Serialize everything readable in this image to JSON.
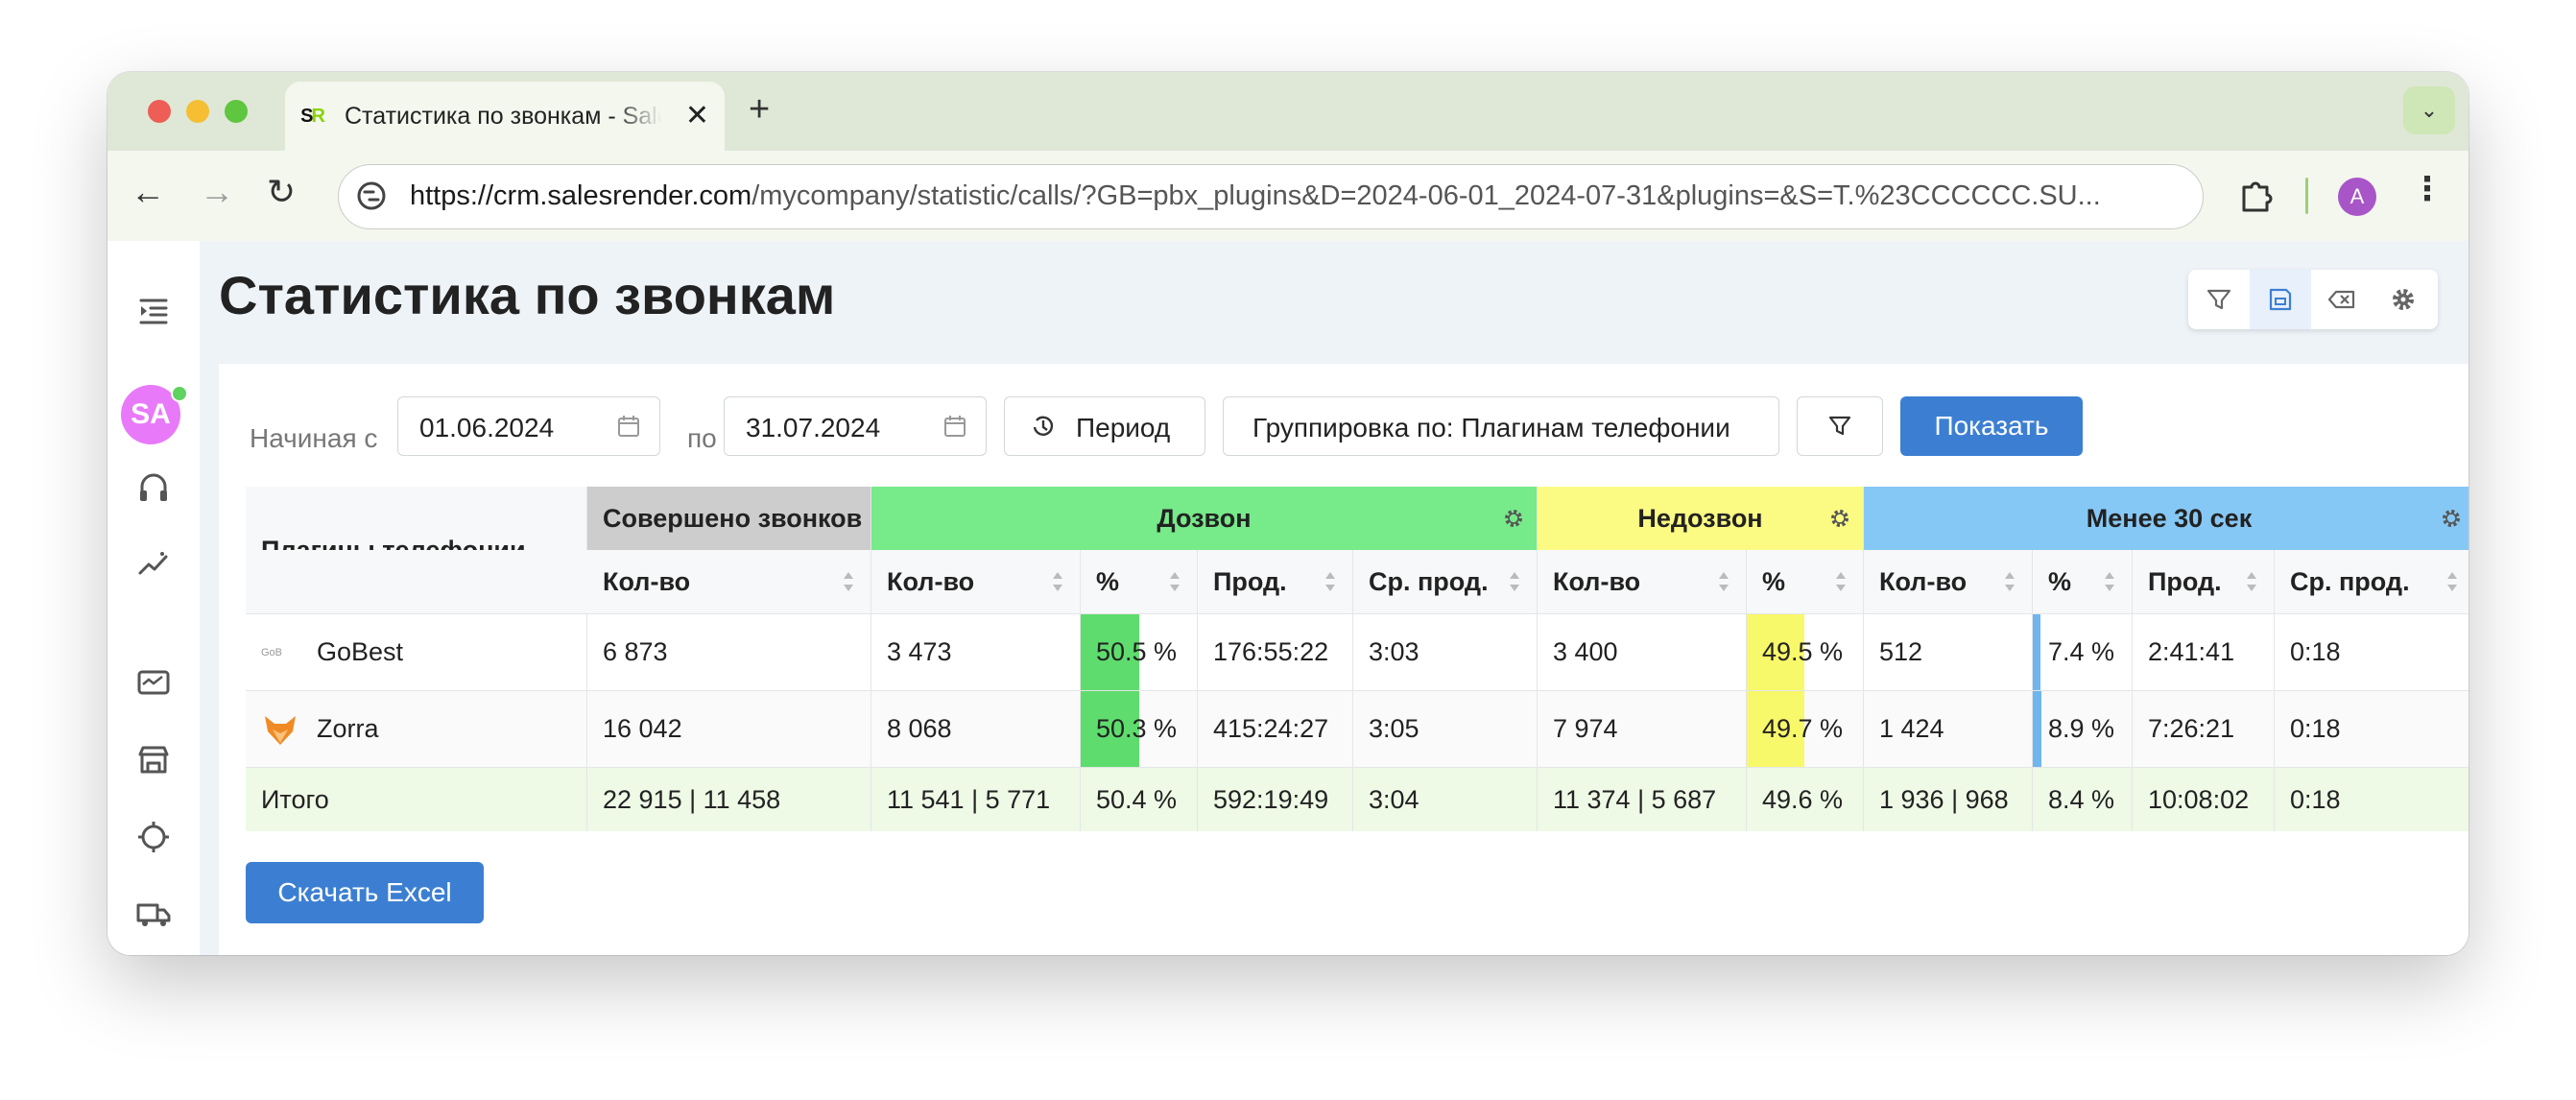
{
  "browser": {
    "tab_title": "Статистика по звонкам - SalesRender",
    "favicon_text_a": "S",
    "favicon_text_b": "R",
    "url_host": "https://crm.salesrender.com",
    "url_path": "/mycompany/statistic/calls/?GB=pbx_plugins&D=2024-06-01_2024-07-31&plugins=&S=T.%23CCCCCC.SU...",
    "profile_initial": "A"
  },
  "sidebar": {
    "avatar_initials": "SA",
    "icons": [
      "indent-icon",
      "headset-icon",
      "analytics-icon",
      "monitor-chart-icon",
      "store-icon",
      "crosshair-icon",
      "truck-icon"
    ]
  },
  "page": {
    "title": "Статистика по звонкам"
  },
  "filters": {
    "from_label": "Начиная с",
    "from_value": "01.06.2024",
    "to_label": "по",
    "to_value": "31.07.2024",
    "period_label": "Период",
    "grouping_label": "Группировка по: Плагинам телефонии",
    "show_label": "Показать"
  },
  "table": {
    "row_header": "Плагины телефонии",
    "groups": {
      "made": "Совершено звонков",
      "reached": "Дозвон",
      "not_reached": "Недозвон",
      "under30": "Менее 30 сек"
    },
    "columns": {
      "count": "Кол-во",
      "pct": "%",
      "dur": "Прод.",
      "avg": "Ср. прод."
    },
    "rows": [
      {
        "name": "GoBest",
        "made": "6 873",
        "r_count": "3 473",
        "r_pct": "50.5 %",
        "r_pct_value": 50.5,
        "r_dur": "176:55:22",
        "r_avg": "3:03",
        "n_count": "3 400",
        "n_pct": "49.5 %",
        "n_pct_value": 49.5,
        "u_count": "512",
        "u_pct": "7.4 %",
        "u_pct_value": 7.4,
        "u_dur": "2:41:41",
        "u_avg": "0:18"
      },
      {
        "name": "Zorra",
        "made": "16 042",
        "r_count": "8 068",
        "r_pct": "50.3 %",
        "r_pct_value": 50.3,
        "r_dur": "415:24:27",
        "r_avg": "3:05",
        "n_count": "7 974",
        "n_pct": "49.7 %",
        "n_pct_value": 49.7,
        "u_count": "1 424",
        "u_pct": "8.9 %",
        "u_pct_value": 8.9,
        "u_dur": "7:26:21",
        "u_avg": "0:18"
      }
    ],
    "total": {
      "label": "Итого",
      "made": "22 915 | 11 458",
      "r_count": "11 541 | 5 771",
      "r_pct": "50.4 %",
      "r_dur": "592:19:49",
      "r_avg": "3:04",
      "n_count": "11 374 | 5 687",
      "n_pct": "49.6 %",
      "u_count": "1 936 | 968",
      "u_pct": "8.4 %",
      "u_dur": "10:08:02",
      "u_avg": "0:18"
    }
  },
  "download_label": "Скачать Excel",
  "colors": {
    "reached": "#77ea8a",
    "reached_bar": "#5fdc6e",
    "not_reached": "#fbfb84",
    "not_reached_bar": "#f8f86b",
    "under30": "#86c8f5",
    "under30_bar": "#6fb6ef",
    "made": "#cdcdcd",
    "total_row": "#eef9e6",
    "primary": "#3c7fd2"
  }
}
